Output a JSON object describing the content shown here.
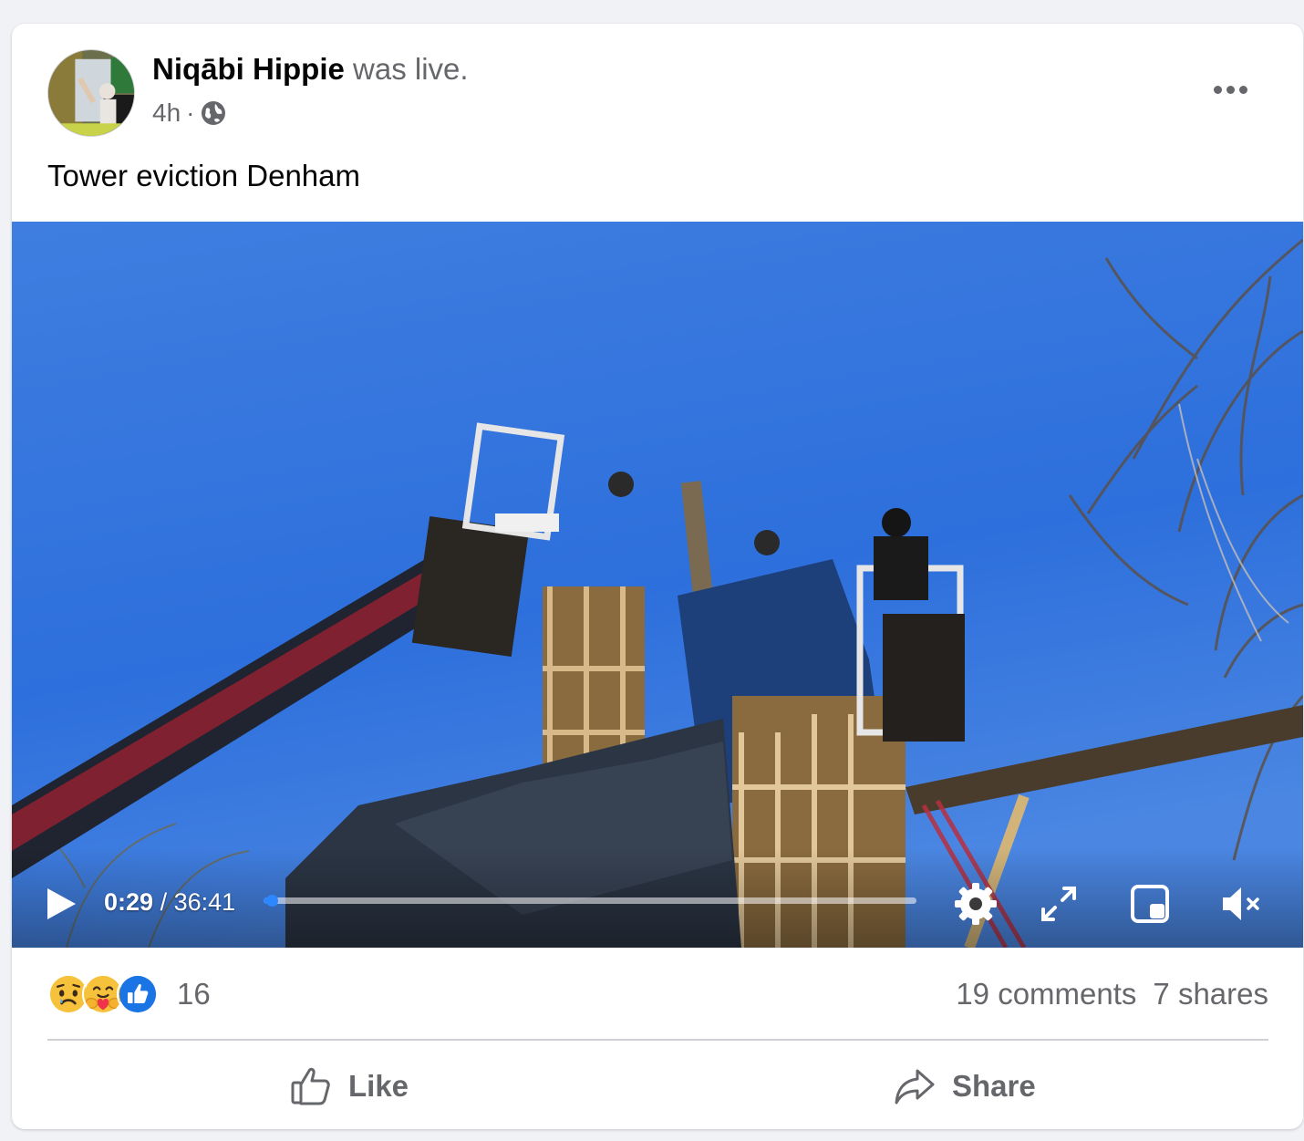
{
  "post": {
    "author_name": "Niqābi Hippie",
    "author_suffix": "was live.",
    "time": "4h",
    "separator": "·",
    "privacy_icon": "globe-icon",
    "text": "Tower eviction Denham"
  },
  "video": {
    "current_time": "0:29",
    "total_time": "/ 36:41",
    "progress_fraction": 0.013,
    "controls": [
      "play-icon",
      "settings-icon",
      "fullscreen-icon",
      "picture-in-picture-icon",
      "muted-volume-icon"
    ]
  },
  "engagement": {
    "reaction_icons": [
      "sad-icon",
      "care-icon",
      "like-icon"
    ],
    "reaction_count": "16",
    "comments": "19 comments",
    "shares": "7 shares"
  },
  "actions": {
    "like_label": "Like",
    "share_label": "Share"
  },
  "colors": {
    "accent": "#2d88ff",
    "secondary_text": "#65676b",
    "sky": "#2f6fd8"
  }
}
